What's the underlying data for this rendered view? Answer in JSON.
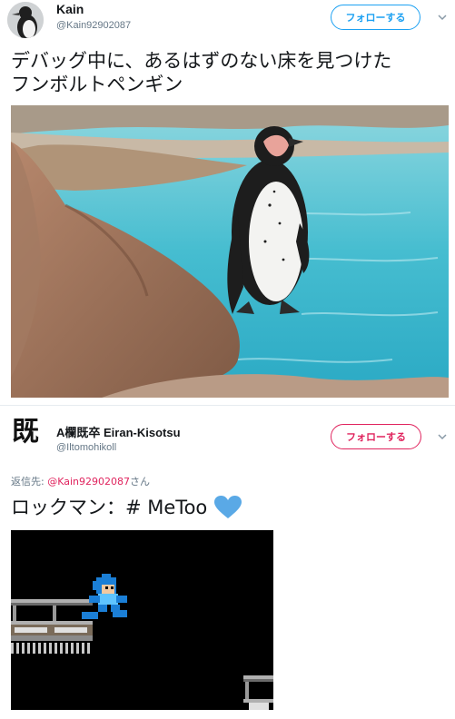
{
  "tweet1": {
    "name": "Kain",
    "handle": "@Kain92902087",
    "follow_label": "フォローする",
    "text_line1": "デバッグ中に、あるはずのない床を見つけた",
    "text_line2": "フンボルトペンギン"
  },
  "tweet2": {
    "name": "A欄既卒 Eiran-Kisotsu",
    "avatar_glyph": "既",
    "handle": "@Iltomohikoll",
    "follow_label": "フォローする",
    "reply_prefix": "返信先: ",
    "reply_handle": "@Kain92902087",
    "reply_suffix": "さん",
    "text": "ロックマン：# MeToo"
  },
  "colors": {
    "accent_blue": "#1da1f2",
    "accent_red": "#e0245e",
    "heart": "#5aa9e6"
  },
  "icons": [
    "chevron-down-icon",
    "heart-icon"
  ]
}
